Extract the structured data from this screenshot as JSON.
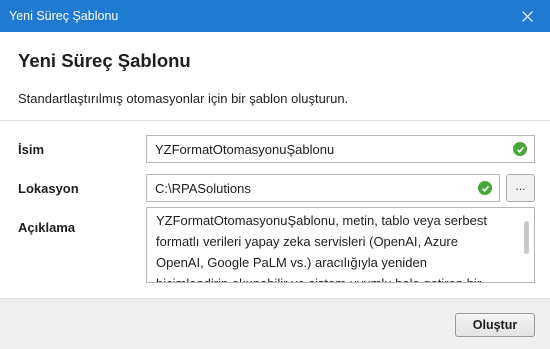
{
  "window": {
    "title": "Yeni Süreç Şablonu",
    "accent_color": "#1f7ad1",
    "close_icon": "close-icon"
  },
  "header": {
    "title": "Yeni Süreç Şablonu",
    "subtitle": "Standartlaştırılmış otomasyonlar için bir şablon oluşturun."
  },
  "form": {
    "name": {
      "label": "İsim",
      "value": "YZFormatOtomasyonuŞablonu",
      "status_icon": "check-circle-icon",
      "status_color": "#4aa63b"
    },
    "location": {
      "label": "Lokasyon",
      "value": "C:\\RPASolutions",
      "status_icon": "check-circle-icon",
      "status_color": "#4aa63b",
      "browse_label": "..."
    },
    "description": {
      "label": "Açıklama",
      "lines": [
        "YZFormatOtomasyonuŞablonu, metin, tablo veya serbest",
        "formatlı verileri yapay zeka servisleri (OpenAI, Azure",
        "OpenAI, Google PaLM vs.) aracılığıyla yeniden",
        "biçimlendirip okunabilir ve sistem uyumlu hale getiren bir"
      ]
    }
  },
  "footer": {
    "create_label": "Oluştur"
  }
}
